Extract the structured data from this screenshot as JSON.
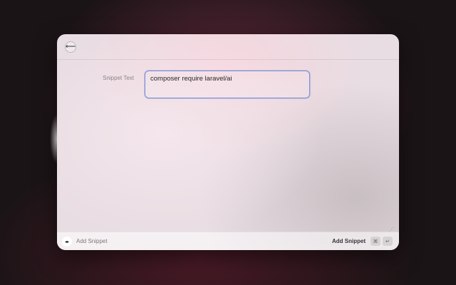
{
  "toolbar": {
    "back_icon": "arrow-left-icon",
    "back_glyph": "⟵"
  },
  "form": {
    "snippet_label": "Snippet Text",
    "snippet_value": "composer require laravel/ai"
  },
  "footer": {
    "extension_icon": "code-brackets-icon",
    "extension_glyph": "◂▸",
    "title": "Add Snippet",
    "action_label": "Add Snippet",
    "shortcut_cmd": "⌘",
    "shortcut_enter": "↵"
  },
  "resize_glyph": "⋰",
  "colors": {
    "focus_border": "#7c8fd4",
    "label_text": "#8a8488"
  }
}
